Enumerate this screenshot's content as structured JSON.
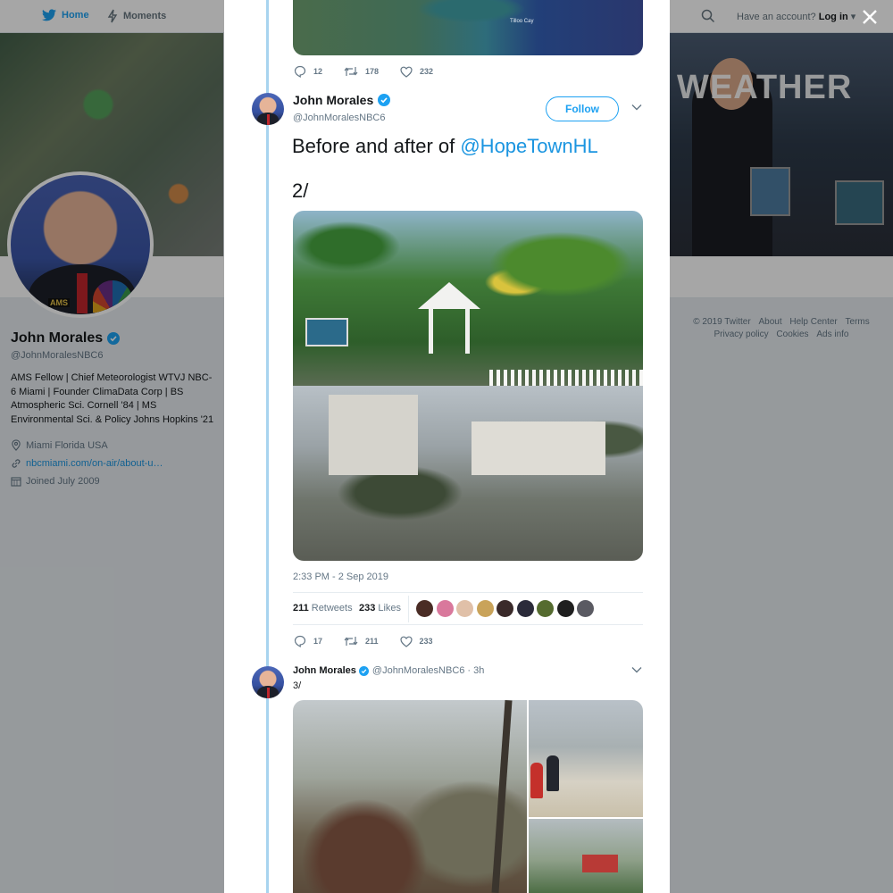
{
  "topbar": {
    "home_label": "Home",
    "moments_label": "Moments",
    "have_account": "Have an account?",
    "login_label": "Log in"
  },
  "banner": {
    "weather_text": "WEATHER"
  },
  "profile": {
    "avatar_badge": "AMS",
    "name": "John Morales",
    "handle": "@JohnMoralesNBC6",
    "bio": "AMS Fellow | Chief Meteorologist WTVJ NBC-6 Miami | Founder ClimaData Corp | BS Atmospheric Sci. Cornell '84 | MS Environmental Sci. & Policy Johns Hopkins '21",
    "location": "Miami Florida USA",
    "website": "nbcmiami.com/on-air/about-u…",
    "joined": "Joined July 2009"
  },
  "footer": {
    "links": [
      "© 2019 Twitter",
      "About",
      "Help Center",
      "Terms"
    ],
    "links2": [
      "Privacy policy",
      "Cookies",
      "Ads info"
    ]
  },
  "prev_tweet": {
    "map_label": "Tilloo Cay",
    "replies": "12",
    "retweets": "178",
    "likes": "232"
  },
  "main_tweet": {
    "name": "John Morales",
    "handle": "@JohnMoralesNBC6",
    "follow_label": "Follow",
    "text_prefix": "Before and after of ",
    "mention": "@HopeTownHL",
    "text_line2": "2/",
    "timestamp": "2:33 PM - 2 Sep 2019",
    "retweets_count": "211",
    "retweets_label": "Retweets",
    "likes_count": "233",
    "likes_label": "Likes",
    "replies": "17",
    "retweets": "211",
    "likes": "233",
    "liker_colors": [
      "#4a2c25",
      "#d9789c",
      "#e0c0a8",
      "#c9a35a",
      "#3a2a2a",
      "#2b2b3a",
      "#556b2f",
      "#1f1f1f",
      "#5a5a62"
    ]
  },
  "next_tweet": {
    "name": "John Morales",
    "handle": "@JohnMoralesNBC6",
    "time": "· 3h",
    "text": "3/"
  },
  "colors": {
    "twitter_blue": "#1da1f2",
    "link_blue": "#1b95e0",
    "thread_line": "#a8d4ef"
  }
}
